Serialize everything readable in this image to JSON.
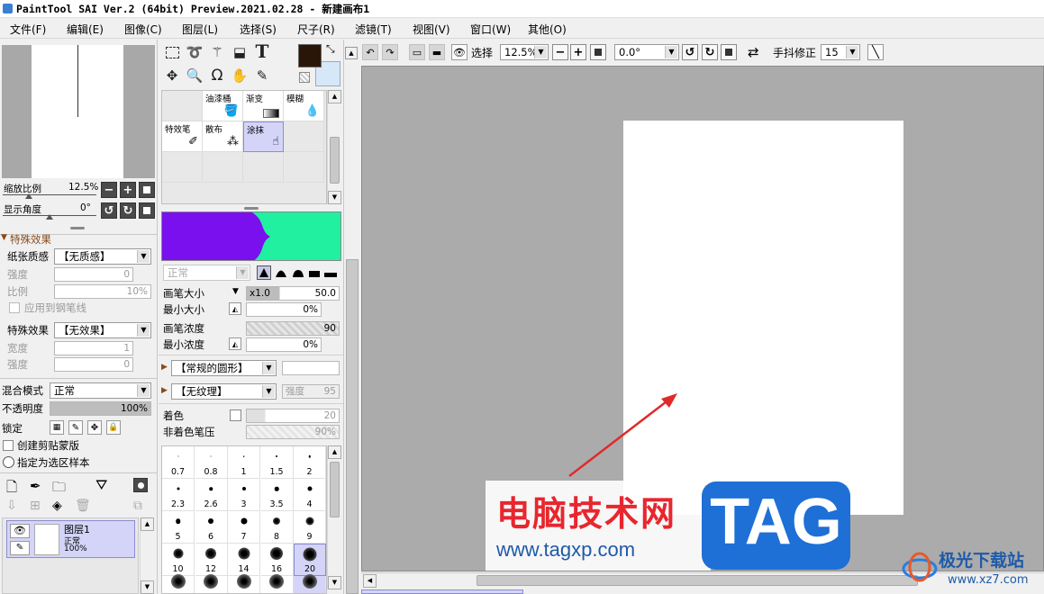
{
  "window": {
    "title": "PaintTool SAI Ver.2 (64bit) Preview.2021.02.28 - 新建画布1"
  },
  "menu": [
    "文件(F)",
    "编辑(E)",
    "图像(C)",
    "图层(L)",
    "选择(S)",
    "尺子(R)",
    "滤镜(T)",
    "视图(V)",
    "窗口(W)",
    "其他(O)"
  ],
  "navigator": {
    "zoom_label": "缩放比例",
    "zoom_value": "12.5%",
    "angle_label": "显示角度",
    "angle_value": "0°"
  },
  "special_effects": {
    "header": "特殊效果",
    "paper_texture_label": "纸张质感",
    "paper_texture_value": "【无质感】",
    "strength_label": "强度",
    "strength_value": "0",
    "scale_label": "比例",
    "scale_value": "10%",
    "apply_pen_label": "应用到钢笔线",
    "effect_label": "特殊效果",
    "effect_value": "【无效果】",
    "width_label": "宽度",
    "width_value": "1",
    "strength2_label": "强度",
    "strength2_value": "0"
  },
  "layer_props": {
    "blend_label": "混合模式",
    "blend_value": "正常",
    "opacity_label": "不透明度",
    "opacity_value": "100%",
    "lock_label": "锁定",
    "clip_label": "创建剪贴蒙版",
    "sample_label": "指定为选区样本"
  },
  "layers": [
    {
      "name": "图层1",
      "mode": "正常",
      "opacity": "100%"
    }
  ],
  "brushes": [
    {
      "label": "",
      "icon": ""
    },
    {
      "label": "油漆桶",
      "icon": "bucket-icon"
    },
    {
      "label": "渐变",
      "icon": "gradient-icon"
    },
    {
      "label": "模糊",
      "icon": "blur-icon"
    },
    {
      "label": "特效笔",
      "icon": "fx-pen-icon"
    },
    {
      "label": "散布",
      "icon": "scatter-icon"
    },
    {
      "label": "涂抹",
      "icon": "smudge-icon"
    }
  ],
  "brush_settings": {
    "mode_value": "正常",
    "size_label": "画笔大小",
    "size_mult": "x1.0",
    "size_value": "50.0",
    "min_size_label": "最小大小",
    "min_size_value": "0%",
    "density_label": "画笔浓度",
    "density_value": "90",
    "min_density_label": "最小浓度",
    "min_density_value": "0%",
    "shape_value": "【常规的圆形】",
    "texture_value": "【无纹理】",
    "texture_strength": "强度",
    "texture_strength_value": "95",
    "color_label": "着色",
    "color_value": "20",
    "noncolor_label": "非着色笔压",
    "noncolor_value": "90%"
  },
  "brush_sizes": [
    "0.7",
    "0.8",
    "1",
    "1.5",
    "2",
    "2.3",
    "2.6",
    "3",
    "3.5",
    "4",
    "5",
    "6",
    "7",
    "8",
    "9",
    "10",
    "12",
    "14",
    "16",
    "20"
  ],
  "toolbar": {
    "select_label": "选择",
    "zoom_value": "12.5%",
    "angle_value": "0.0°",
    "stabilizer_label": "手抖修正",
    "stabilizer_value": "15"
  },
  "colors": {
    "primary": "#2a1608",
    "secondary": "#d6e8f8",
    "accent": "#3a7fd0"
  },
  "watermark": {
    "cn_text": "电脑技术网",
    "url": "www.tagxp.com",
    "tag": "TAG",
    "site": "极光下载站",
    "site_url": "www.xz7.com"
  }
}
